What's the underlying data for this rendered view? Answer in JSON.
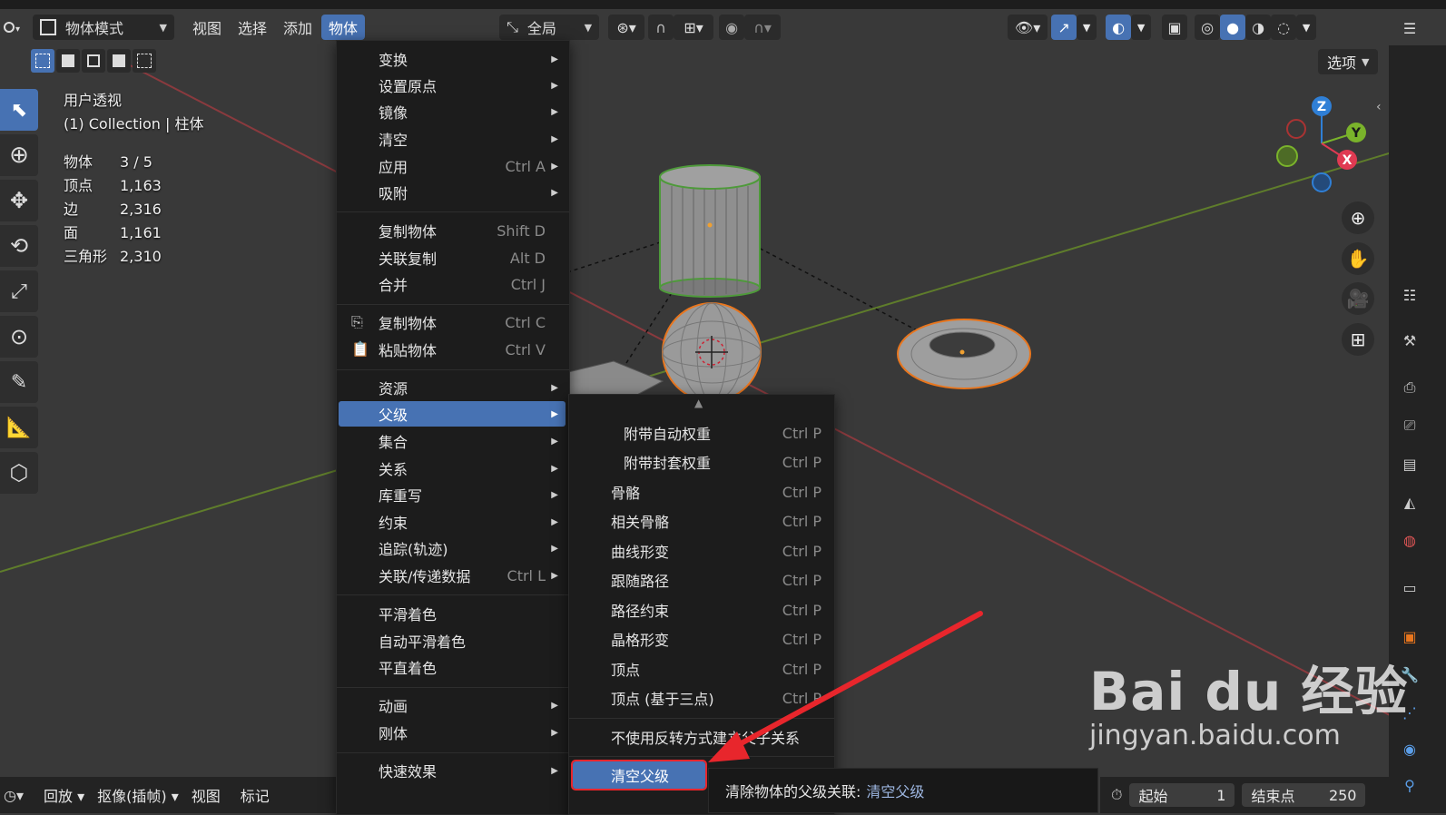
{
  "header": {
    "mode_label": "物体模式",
    "menus": [
      "视图",
      "选择",
      "添加",
      "物体"
    ],
    "orientation_label": "全局",
    "options_label": "选项"
  },
  "stats": {
    "view_name": "用户透视",
    "collection_line": "(1) Collection | 柱体",
    "rows": [
      {
        "k": "物体",
        "v": "3 / 5"
      },
      {
        "k": "顶点",
        "v": "1,163"
      },
      {
        "k": "边",
        "v": "2,316"
      },
      {
        "k": "面",
        "v": "1,161"
      },
      {
        "k": "三角形",
        "v": "2,310"
      }
    ]
  },
  "object_menu": {
    "items": [
      {
        "label": "变换",
        "shortcut": "",
        "submenu": true
      },
      {
        "label": "设置原点",
        "shortcut": "",
        "submenu": true
      },
      {
        "label": "镜像",
        "shortcut": "",
        "submenu": true
      },
      {
        "label": "清空",
        "shortcut": "",
        "submenu": true
      },
      {
        "label": "应用",
        "shortcut": "Ctrl A",
        "submenu": true
      },
      {
        "label": "吸附",
        "shortcut": "",
        "submenu": true
      },
      {
        "label": "复制物体",
        "shortcut": "Shift D",
        "submenu": false
      },
      {
        "label": "关联复制",
        "shortcut": "Alt D",
        "submenu": false
      },
      {
        "label": "合并",
        "shortcut": "Ctrl J",
        "submenu": false
      },
      {
        "label": "复制物体",
        "shortcut": "Ctrl C",
        "submenu": false
      },
      {
        "label": "粘贴物体",
        "shortcut": "Ctrl V",
        "submenu": false
      },
      {
        "label": "资源",
        "shortcut": "",
        "submenu": true
      },
      {
        "label": "父级",
        "shortcut": "",
        "submenu": true
      },
      {
        "label": "集合",
        "shortcut": "",
        "submenu": true
      },
      {
        "label": "关系",
        "shortcut": "",
        "submenu": true
      },
      {
        "label": "库重写",
        "shortcut": "",
        "submenu": true
      },
      {
        "label": "约束",
        "shortcut": "",
        "submenu": true
      },
      {
        "label": "追踪(轨迹)",
        "shortcut": "",
        "submenu": true
      },
      {
        "label": "关联/传递数据",
        "shortcut": "Ctrl L",
        "submenu": true
      },
      {
        "label": "平滑着色",
        "shortcut": "",
        "submenu": false
      },
      {
        "label": "自动平滑着色",
        "shortcut": "",
        "submenu": false
      },
      {
        "label": "平直着色",
        "shortcut": "",
        "submenu": false
      },
      {
        "label": "动画",
        "shortcut": "",
        "submenu": true
      },
      {
        "label": "刚体",
        "shortcut": "",
        "submenu": true
      },
      {
        "label": "快速效果",
        "shortcut": "",
        "submenu": true
      }
    ]
  },
  "parent_submenu": {
    "scroll_up": "▲",
    "items": [
      {
        "label": "附带自动权重",
        "shortcut": "Ctrl P"
      },
      {
        "label": "附带封套权重",
        "shortcut": "Ctrl P"
      },
      {
        "label": "骨骼",
        "shortcut": "Ctrl P"
      },
      {
        "label": "相关骨骼",
        "shortcut": "Ctrl P"
      },
      {
        "label": "曲线形变",
        "shortcut": "Ctrl P"
      },
      {
        "label": "跟随路径",
        "shortcut": "Ctrl P"
      },
      {
        "label": "路径约束",
        "shortcut": "Ctrl P"
      },
      {
        "label": "晶格形变",
        "shortcut": "Ctrl P"
      },
      {
        "label": "顶点",
        "shortcut": "Ctrl P"
      },
      {
        "label": "顶点 (基于三点)",
        "shortcut": "Ctrl P"
      },
      {
        "label": "不使用反转方式建立父子关系",
        "shortcut": ""
      },
      {
        "label": "清空父级",
        "shortcut": ""
      }
    ]
  },
  "tooltip": {
    "text": "清除物体的父级关联:",
    "hint": "清空父级"
  },
  "footer": {
    "items": [
      "回放",
      "抠像(插帧)",
      "视图",
      "标记"
    ]
  },
  "timeline": {
    "start_label": "起始",
    "start_value": "1",
    "end_label": "结束点",
    "end_value": "250"
  },
  "gizmo": {
    "z": "Z",
    "y": "Y",
    "x": "X"
  },
  "watermark": {
    "brand": "Bai du 经验",
    "url": "jingyan.baidu.com"
  },
  "colors": {
    "accent": "#4772b3",
    "selected_outline": "#e8761e",
    "axis_x": "#e03a52",
    "axis_y": "#7ab32b",
    "axis_z": "#2f7fd6",
    "annotation": "#e8262c"
  }
}
